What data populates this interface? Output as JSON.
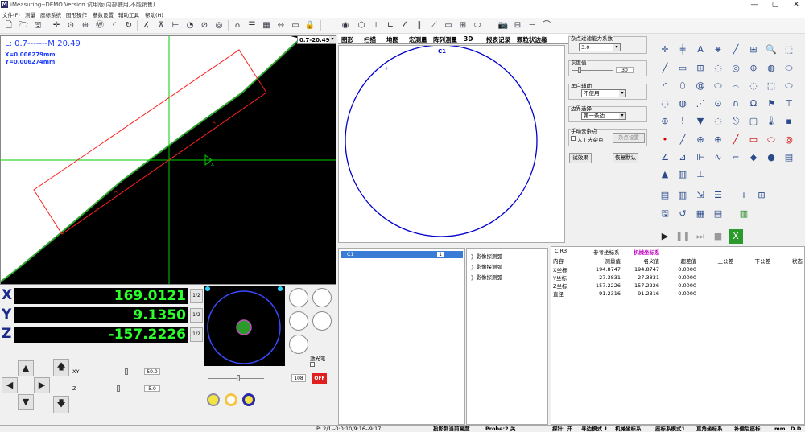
{
  "titlebar": {
    "title": "iMeasuring--DEMO  Version  试用版(内部使用,不能销售)",
    "minimize": "—",
    "maximize": "▢",
    "close": "✕"
  },
  "menu": {
    "items": [
      "文件(F)",
      "测量",
      "座标系统",
      "图形操作",
      "参数设置",
      "辅助工具",
      "帮助(H)"
    ]
  },
  "view": {
    "info_line": "L: 0.7-------M:20.49",
    "x_readout": "X=0.006279mm",
    "y_readout": "Y=0.006274mm",
    "zoom_value": "0.7-20.49",
    "colors": {
      "background": "#000000",
      "crosshair": "#00cc00",
      "edge": "#ffffff",
      "roi": "#ff2020"
    }
  },
  "graph_tabs": [
    "图形",
    "扫描",
    "地图",
    "宏测量",
    "阵列测量",
    "3D",
    "报表记录",
    "颗粒状边缘"
  ],
  "graph": {
    "circle_label": "C1",
    "circle_color": "#0000cc"
  },
  "settings": {
    "filter_label": "杂点过滤能力系数",
    "filter_value": "3.0",
    "gray_label": "灰度值",
    "gray_value": "30",
    "bw_label": "黑白辅助",
    "bw_value": "不使用",
    "edge_label": "边界选择",
    "edge_value": "第一条边",
    "manual_label": "手动去杂点",
    "manual_check": "人工去杂点",
    "manual_btn": "杂点设置",
    "test_btn": "试效果",
    "default_btn": "恢复默认"
  },
  "coords": {
    "x_label": "X",
    "x_value": "169.0121",
    "y_label": "Y",
    "y_value": "9.1350",
    "z_label": "Z",
    "z_value": "-157.2226",
    "half": "1/2"
  },
  "motion": {
    "xy_label": "XY",
    "xy_value": "50.0",
    "z_label": "Z",
    "z_value": "5.0"
  },
  "light": {
    "laser_label": "激光笔",
    "level_value": "108",
    "off_label": "OFF"
  },
  "features": {
    "items": [
      {
        "name": "C1",
        "count": "1"
      }
    ],
    "sub_items": [
      "影像探测弧",
      "影像探测弧",
      "影像探测弧"
    ]
  },
  "result": {
    "feature": "CIR3",
    "ref_sys": "参考坐标系",
    "mach_sys": "机械坐标系",
    "columns": [
      "内容",
      "测量值",
      "名义值",
      "超差值",
      "上公差",
      "下公差",
      "状态"
    ],
    "rows": [
      [
        "X坐标",
        "194.8747",
        "194.8747",
        "0.0000",
        "",
        "",
        ""
      ],
      [
        "Y坐标",
        "-27.3831",
        "-27.3831",
        "0.0000",
        "",
        "",
        ""
      ],
      [
        "Z坐标",
        "-157.2226",
        "-157.2226",
        "0.0000",
        "",
        "",
        ""
      ],
      [
        "直径",
        "91.2316",
        "91.2316",
        "0.0000",
        "",
        "",
        ""
      ]
    ]
  },
  "status": {
    "p": "P: 2/1--0:0:10/9:16--9:17",
    "proj": "投影到当前高度",
    "probe": "Probe:2 关",
    "probe_on": "探针: 开",
    "edge_mode": "寻边模式 1",
    "mach": "机械坐标系",
    "coord_mode": "座标系模式1",
    "rect": "直角坐标系",
    "comp": "补偿后座标",
    "unit": "mm",
    "dd": "D.D"
  }
}
